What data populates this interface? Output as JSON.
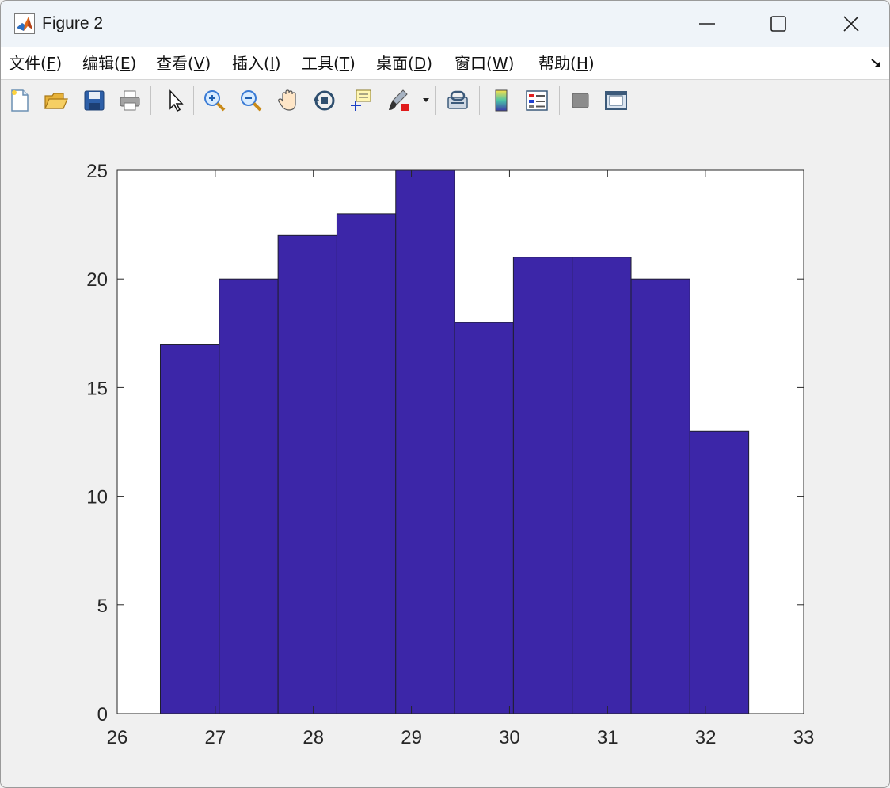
{
  "window": {
    "title": "Figure 2"
  },
  "menu": {
    "items": [
      {
        "label": "文件(",
        "key": "F",
        "suffix": ")"
      },
      {
        "label": "编辑(",
        "key": "E",
        "suffix": ")"
      },
      {
        "label": "查看(",
        "key": "V",
        "suffix": ")"
      },
      {
        "label": "插入(",
        "key": "I",
        "suffix": ")"
      },
      {
        "label": "工具(",
        "key": "T",
        "suffix": ")"
      },
      {
        "label": "桌面(",
        "key": "D",
        "suffix": ")"
      },
      {
        "label": "窗口(",
        "key": "W",
        "suffix": ")"
      },
      {
        "label": "帮助(",
        "key": "H",
        "suffix": ")"
      }
    ],
    "dock_icon": "dock-arrow-icon"
  },
  "toolbar": {
    "icons": [
      "new-figure-icon",
      "open-file-icon",
      "save-icon",
      "print-icon",
      "pointer-icon",
      "zoom-in-icon",
      "zoom-out-icon",
      "pan-hand-icon",
      "rotate-3d-icon",
      "data-cursor-icon",
      "brush-icon",
      "link-plot-icon",
      "colorbar-icon",
      "legend-icon",
      "hide-plot-tools-icon",
      "show-plot-tools-icon"
    ]
  },
  "colors": {
    "bar_fill": "#3c26a8",
    "bar_edge": "#1f1f2e",
    "axes_bg": "#ffffff",
    "figure_bg": "#f0f0f0"
  },
  "chart_data": {
    "type": "bar",
    "subtype": "histogram",
    "bins": [
      {
        "x0": 26.44,
        "x1": 27.04,
        "value": 17
      },
      {
        "x0": 27.04,
        "x1": 27.64,
        "value": 20
      },
      {
        "x0": 27.64,
        "x1": 28.24,
        "value": 22
      },
      {
        "x0": 28.24,
        "x1": 28.84,
        "value": 23
      },
      {
        "x0": 28.84,
        "x1": 29.44,
        "value": 25
      },
      {
        "x0": 29.44,
        "x1": 30.04,
        "value": 18
      },
      {
        "x0": 30.04,
        "x1": 30.64,
        "value": 21
      },
      {
        "x0": 30.64,
        "x1": 31.24,
        "value": 21
      },
      {
        "x0": 31.24,
        "x1": 31.84,
        "value": 20
      },
      {
        "x0": 31.84,
        "x1": 32.44,
        "value": 13
      }
    ],
    "xlim": [
      26,
      33
    ],
    "ylim": [
      0,
      25
    ],
    "xticks": [
      26,
      27,
      28,
      29,
      30,
      31,
      32,
      33
    ],
    "yticks": [
      0,
      5,
      10,
      15,
      20,
      25
    ],
    "grid": false,
    "legend": "none"
  }
}
